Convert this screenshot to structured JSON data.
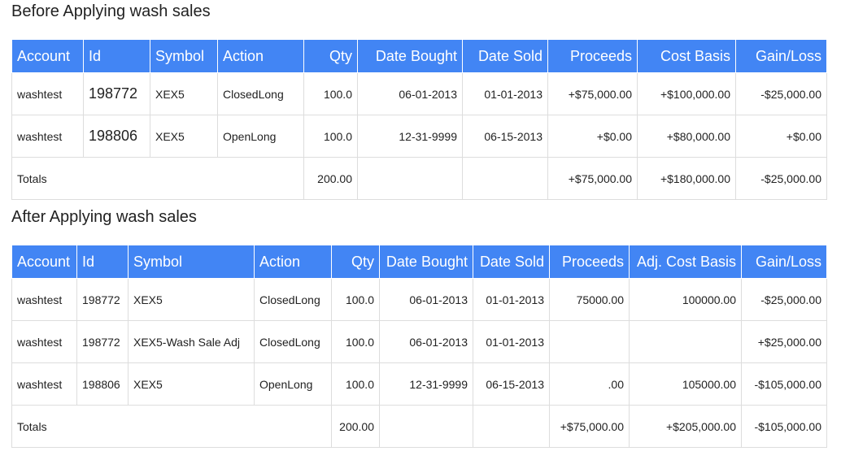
{
  "before": {
    "title": "Before Applying wash sales",
    "headers": [
      "Account",
      "Id",
      "Symbol",
      "Action",
      "Qty",
      "Date Bought",
      "Date Sold",
      "Proceeds",
      "Cost Basis",
      "Gain/Loss"
    ],
    "rows": [
      {
        "account": "washtest",
        "id": "198772",
        "symbol": "XEX5",
        "action": "ClosedLong",
        "qty": "100.0",
        "date_bought": "06-01-2013",
        "date_sold": "01-01-2013",
        "proceeds": "+$75,000.00",
        "cost_basis": "+$100,000.00",
        "gain_loss": "-$25,000.00"
      },
      {
        "account": "washtest",
        "id": "198806",
        "symbol": "XEX5",
        "action": "OpenLong",
        "qty": "100.0",
        "date_bought": "12-31-9999",
        "date_sold": "06-15-2013",
        "proceeds": "+$0.00",
        "cost_basis": "+$80,000.00",
        "gain_loss": "+$0.00"
      }
    ],
    "totals": {
      "label": "Totals",
      "qty": "200.00",
      "proceeds": "+$75,000.00",
      "cost_basis": "+$180,000.00",
      "gain_loss": "-$25,000.00"
    }
  },
  "after": {
    "title": "After Applying wash sales",
    "headers": [
      "Account",
      "Id",
      "Symbol",
      "Action",
      "Qty",
      "Date Bought",
      "Date Sold",
      "Proceeds",
      "Adj. Cost Basis",
      "Gain/Loss"
    ],
    "rows": [
      {
        "account": "washtest",
        "id": "198772",
        "symbol": "XEX5",
        "action": "ClosedLong",
        "qty": "100.0",
        "date_bought": "06-01-2013",
        "date_sold": "01-01-2013",
        "proceeds": "75000.00",
        "cost_basis": "100000.00",
        "gain_loss": "-$25,000.00"
      },
      {
        "account": "washtest",
        "id": "198772",
        "symbol": "XEX5-Wash Sale Adj",
        "action": "ClosedLong",
        "qty": "100.0",
        "date_bought": "06-01-2013",
        "date_sold": "01-01-2013",
        "proceeds": "",
        "cost_basis": "",
        "gain_loss": "+$25,000.00"
      },
      {
        "account": "washtest",
        "id": "198806",
        "symbol": "XEX5",
        "action": "OpenLong",
        "qty": "100.0",
        "date_bought": "12-31-9999",
        "date_sold": "06-15-2013",
        "proceeds": ".00",
        "cost_basis": "105000.00",
        "gain_loss": "-$105,000.00"
      }
    ],
    "totals": {
      "label": "Totals",
      "qty": "200.00",
      "proceeds": "+$75,000.00",
      "cost_basis": "+$205,000.00",
      "gain_loss": "-$105,000.00"
    }
  },
  "colors": {
    "header_bg": "#4285f4",
    "negative": "#e53935",
    "positive": "#1fad3c"
  }
}
